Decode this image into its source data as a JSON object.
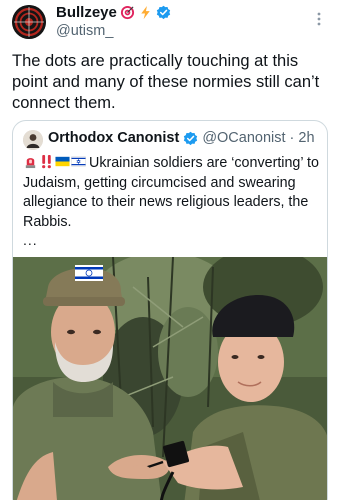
{
  "author": {
    "display_name": "Bullzeye",
    "handle": "@utism_",
    "avatar_icon": "bullseye-avatar",
    "badges": [
      "target-emoji",
      "lightning-emoji",
      "verified-badge"
    ]
  },
  "tweet": {
    "text": "The dots are practically touching at this point and many of these normies still can’t connect them."
  },
  "quoted": {
    "display_name": "Orthodox Canonist",
    "handle": "@OCanonist",
    "separator": "·",
    "time": "2h",
    "emojis": [
      "siren-emoji",
      "double-exclamation-emoji",
      "ukraine-flag-emoji",
      "israel-flag-emoji"
    ],
    "text": "Ukrainian soldiers are ‘converting’ to Judaism, getting circumcised and swearing allegiance to their news religious leaders, the Rabbis.",
    "ellipsis": "...",
    "media_description_icon": "photo-soldiers-tefillin"
  },
  "colors": {
    "verified": "#1d9bf0",
    "secondary_text": "#536471",
    "border": "#cfd9de"
  }
}
